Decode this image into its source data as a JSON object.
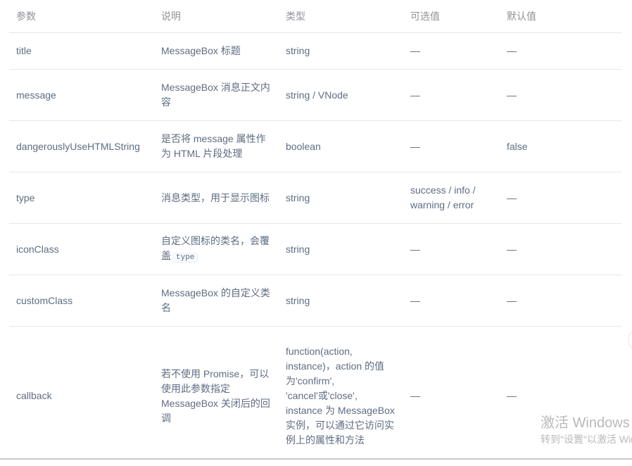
{
  "table": {
    "headers": [
      "参数",
      "说明",
      "类型",
      "可选值",
      "默认值"
    ],
    "rows": [
      {
        "param": "title",
        "desc": "MessageBox 标题",
        "type": "string",
        "options": "—",
        "default": "—"
      },
      {
        "param": "message",
        "desc": "MessageBox 消息正文内容",
        "type": "string / VNode",
        "options": "—",
        "default": "—"
      },
      {
        "param": "dangerouslyUseHTMLString",
        "desc": "是否将 message 属性作为 HTML 片段处理",
        "type": "boolean",
        "options": "—",
        "default": "false"
      },
      {
        "param": "type",
        "desc": "消息类型，用于显示图标",
        "type": "string",
        "options": "success / info / warning / error",
        "default": "—"
      },
      {
        "param": "iconClass",
        "desc": "自定义图标的类名，会覆盖",
        "desc_code": "type",
        "type": "string",
        "options": "—",
        "default": "—"
      },
      {
        "param": "customClass",
        "desc": "MessageBox 的自定义类名",
        "type": "string",
        "options": "—",
        "default": "—"
      },
      {
        "param": "callback",
        "desc": "若不使用 Promise，可以使用此参数指定 MessageBox 关闭后的回调",
        "type": "function(action, instance)，action 的值为'confirm', 'cancel'或'close', instance 为 MessageBox 实例，可以通过它访问实例上的属性和方法",
        "options": "—",
        "default": "—"
      }
    ]
  },
  "watermark": {
    "line1": "激活 Windows",
    "line2": "转到\"设置\"以激活 Windows。"
  }
}
